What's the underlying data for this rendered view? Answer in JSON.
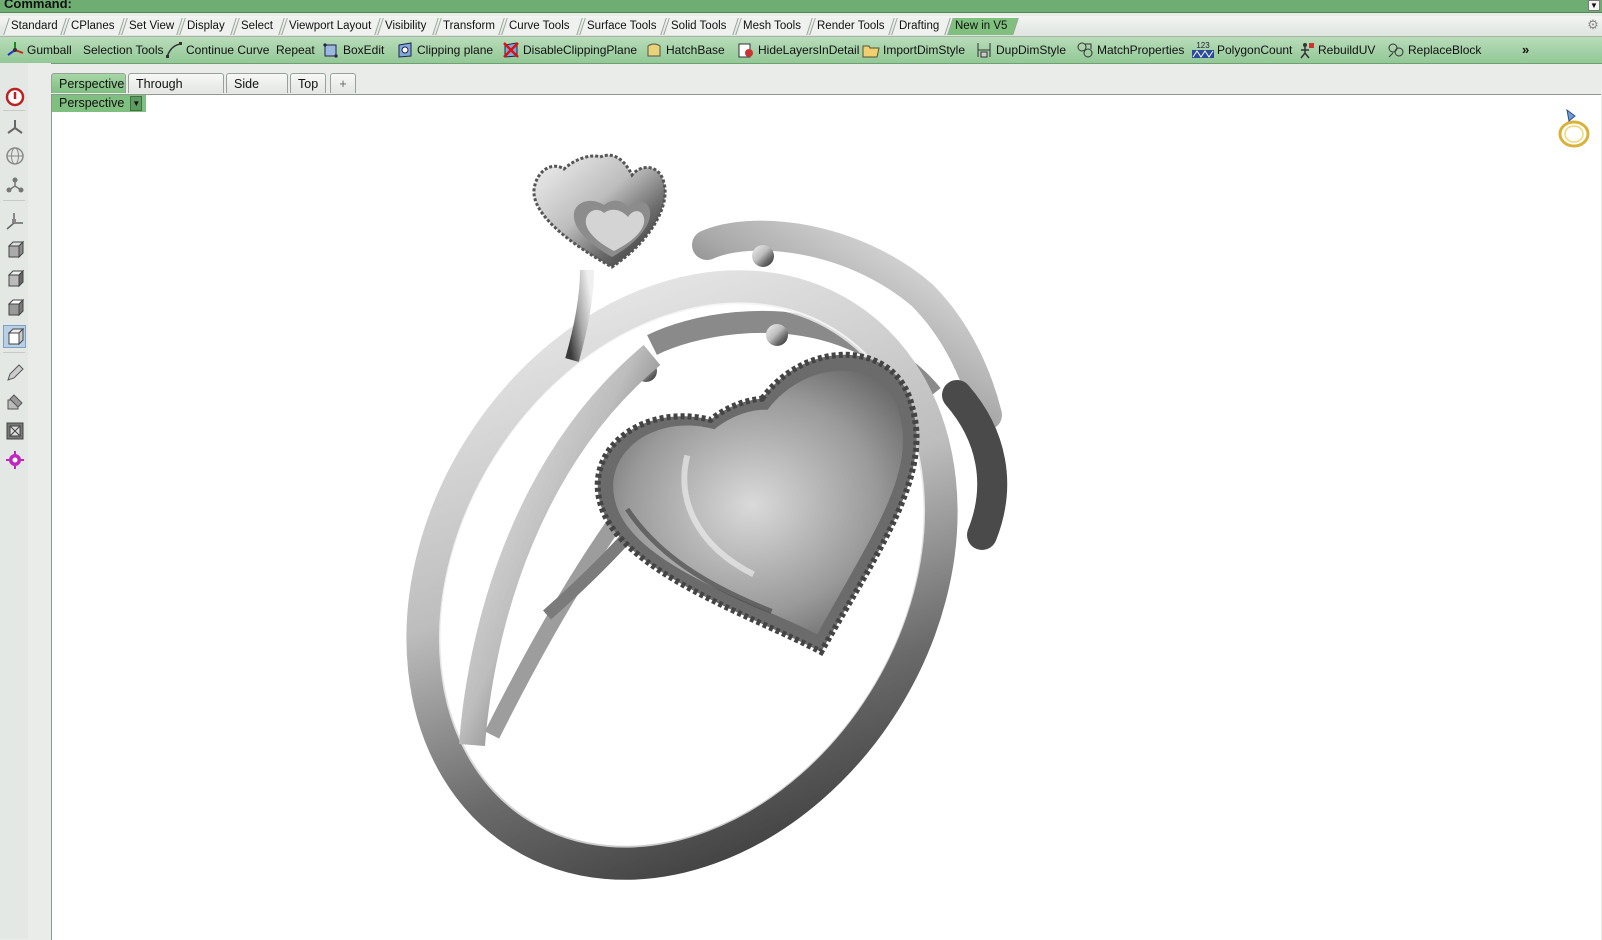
{
  "command_bar": {
    "label": "Command:"
  },
  "toolbar_groups": [
    {
      "label": "Standard",
      "active": false
    },
    {
      "label": "CPlanes",
      "active": false
    },
    {
      "label": "Set View",
      "active": false
    },
    {
      "label": "Display",
      "active": false
    },
    {
      "label": "Select",
      "active": false
    },
    {
      "label": "Viewport Layout",
      "active": false
    },
    {
      "label": "Visibility",
      "active": false
    },
    {
      "label": "Transform",
      "active": false
    },
    {
      "label": "Curve Tools",
      "active": false
    },
    {
      "label": "Surface Tools",
      "active": false
    },
    {
      "label": "Solid Tools",
      "active": false
    },
    {
      "label": "Mesh Tools",
      "active": false
    },
    {
      "label": "Render Tools",
      "active": false
    },
    {
      "label": "Drafting",
      "active": false
    },
    {
      "label": "New in V5",
      "active": true
    }
  ],
  "toolbar_buttons": [
    {
      "label": "Gumball",
      "icon": "gumball-icon"
    },
    {
      "label": "Selection Tools",
      "icon": ""
    },
    {
      "label": "Continue Curve",
      "icon": "curve-icon"
    },
    {
      "label": "Repeat",
      "icon": ""
    },
    {
      "label": "BoxEdit",
      "icon": "box-edit-icon"
    },
    {
      "label": "Clipping plane",
      "icon": "clipping-plane-icon"
    },
    {
      "label": "DisableClippingPlane",
      "icon": "disable-clipping-icon"
    },
    {
      "label": "HatchBase",
      "icon": "hatch-icon"
    },
    {
      "label": "HideLayersInDetail",
      "icon": "layers-icon"
    },
    {
      "label": "ImportDimStyle",
      "icon": "folder-icon"
    },
    {
      "label": "DupDimStyle",
      "icon": "dimension-icon"
    },
    {
      "label": "MatchProperties",
      "icon": "match-properties-icon"
    },
    {
      "label": "PolygonCount",
      "icon": "polygon-count-icon"
    },
    {
      "label": "RebuildUV",
      "icon": "rebuild-uv-icon"
    },
    {
      "label": "ReplaceBlock",
      "icon": "replace-block-icon"
    }
  ],
  "toolbar_more": "»",
  "polygon_icon_text": "123",
  "viewport_tabs": [
    {
      "label": "Perspective",
      "active": true
    },
    {
      "label": "Through Finger",
      "active": false
    },
    {
      "label": "Side View",
      "active": false
    },
    {
      "label": "Top",
      "active": false
    }
  ],
  "add_tab": "+",
  "viewport": {
    "title": "Perspective",
    "model": "heart ring"
  },
  "colors": {
    "accent_green": "#7fbf80",
    "command_bar": "#6fae72",
    "toolbar": "#a8d3aa"
  }
}
